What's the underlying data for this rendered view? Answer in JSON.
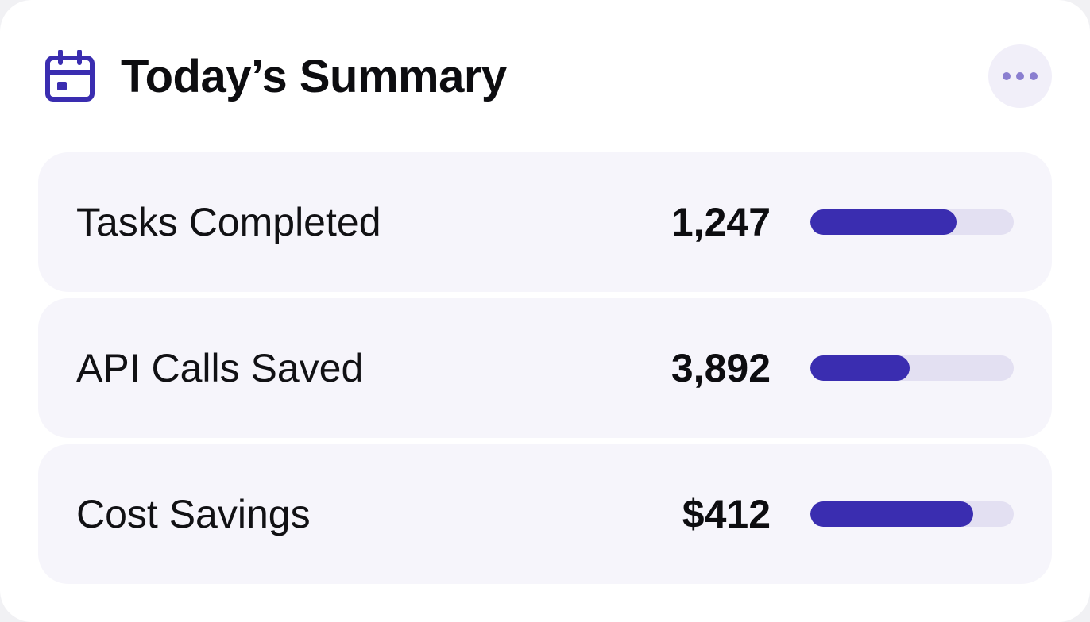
{
  "header": {
    "title": "Today’s Summary",
    "icon": "calendar-icon",
    "more_icon": "more-horizontal-icon"
  },
  "colors": {
    "accent": "#3a2db0",
    "track": "#e3e0f2",
    "row_bg": "#f6f5fb",
    "icon": "#3a2db0"
  },
  "metrics": [
    {
      "label": "Tasks Completed",
      "value": "1,247",
      "progress": 0.72
    },
    {
      "label": "API Calls Saved",
      "value": "3,892",
      "progress": 0.49
    },
    {
      "label": "Cost Savings",
      "value": "$412",
      "progress": 0.8
    }
  ]
}
